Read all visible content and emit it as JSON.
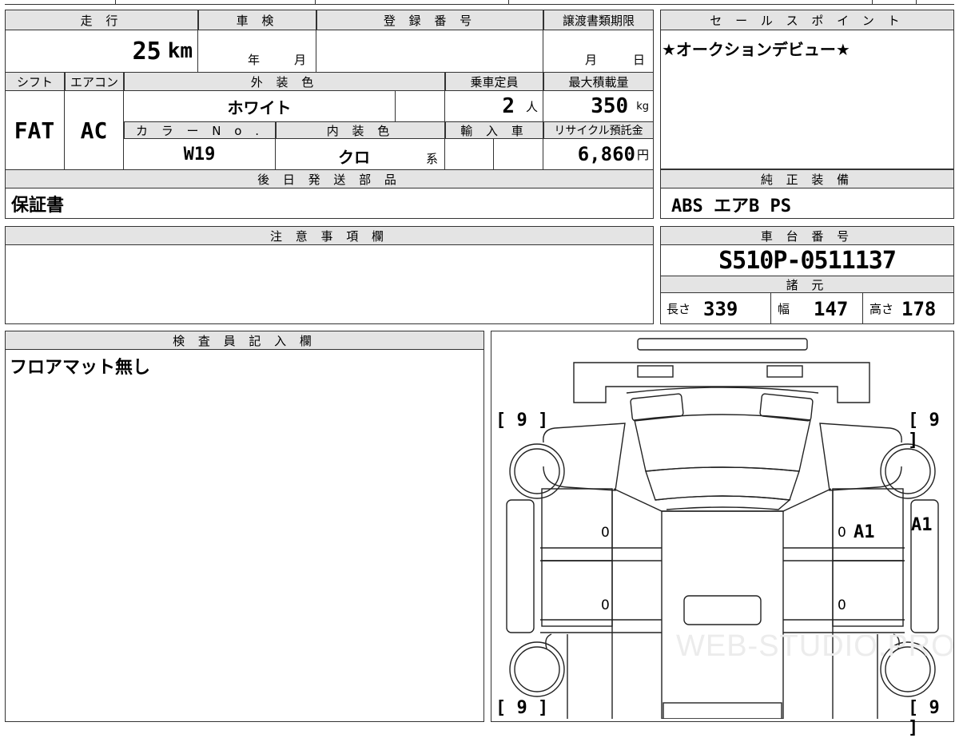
{
  "headers": {
    "mileage": "走 行",
    "inspection": "車 検",
    "registration": "登 録 番 号",
    "transfer_deadline": "譲渡書類期限",
    "sales_point": "セ ー ル ス ポ イ ン ト",
    "shift": "シフト",
    "aircon": "エアコン",
    "exterior_color": "外 装 色",
    "capacity": "乗車定員",
    "max_load": "最大積載量",
    "color_no": "カ ラ ー N o .",
    "interior_color": "内 装 色",
    "import": "輸 入 車",
    "recycle": "リサイクル預託金",
    "later_parts": "後 日 発 送 部 品",
    "genuine_equipment": "純 正 装 備",
    "notes": "注 意 事 項 欄",
    "chassis_no": "車 台 番 号",
    "specs": "諸 元",
    "inspector_notes": "検 査 員 記 入 欄"
  },
  "values": {
    "mileage": "25",
    "mileage_unit": "km",
    "year_unit": "年",
    "month_unit": "月",
    "deadline_month": "月",
    "deadline_day": "日",
    "sales_point": "★オークションデビュー★",
    "shift": "FAT",
    "aircon": "AC",
    "exterior_color": "ホワイト",
    "capacity": "2",
    "capacity_unit": "人",
    "max_load": "350",
    "max_load_unit": "kg",
    "color_no": "W19",
    "interior_color": "クロ",
    "interior_suffix": "系",
    "recycle": "6,860",
    "recycle_unit": "円",
    "later_parts": "保証書",
    "genuine_equipment": "ABS エアB PS",
    "chassis_no": "S510P-0511137",
    "length_label": "長さ",
    "length": "339",
    "width_label": "幅",
    "width": "147",
    "height_label": "高さ",
    "height": "178",
    "inspector_notes": "フロアマット無し"
  },
  "diagram": {
    "corner_tl": "[ 9 ]",
    "corner_tr": "[ 9 ]",
    "corner_bl": "[ 9 ]",
    "corner_br": "[ 9 ]",
    "mark_left_upper": "0",
    "mark_left_lower": "0",
    "mark_right_upper": "0",
    "mark_right_lower": "0",
    "mark_a1_inner": "A1",
    "mark_a1_side": "A1",
    "watermark": "WEB-STUDIO.PRO"
  }
}
